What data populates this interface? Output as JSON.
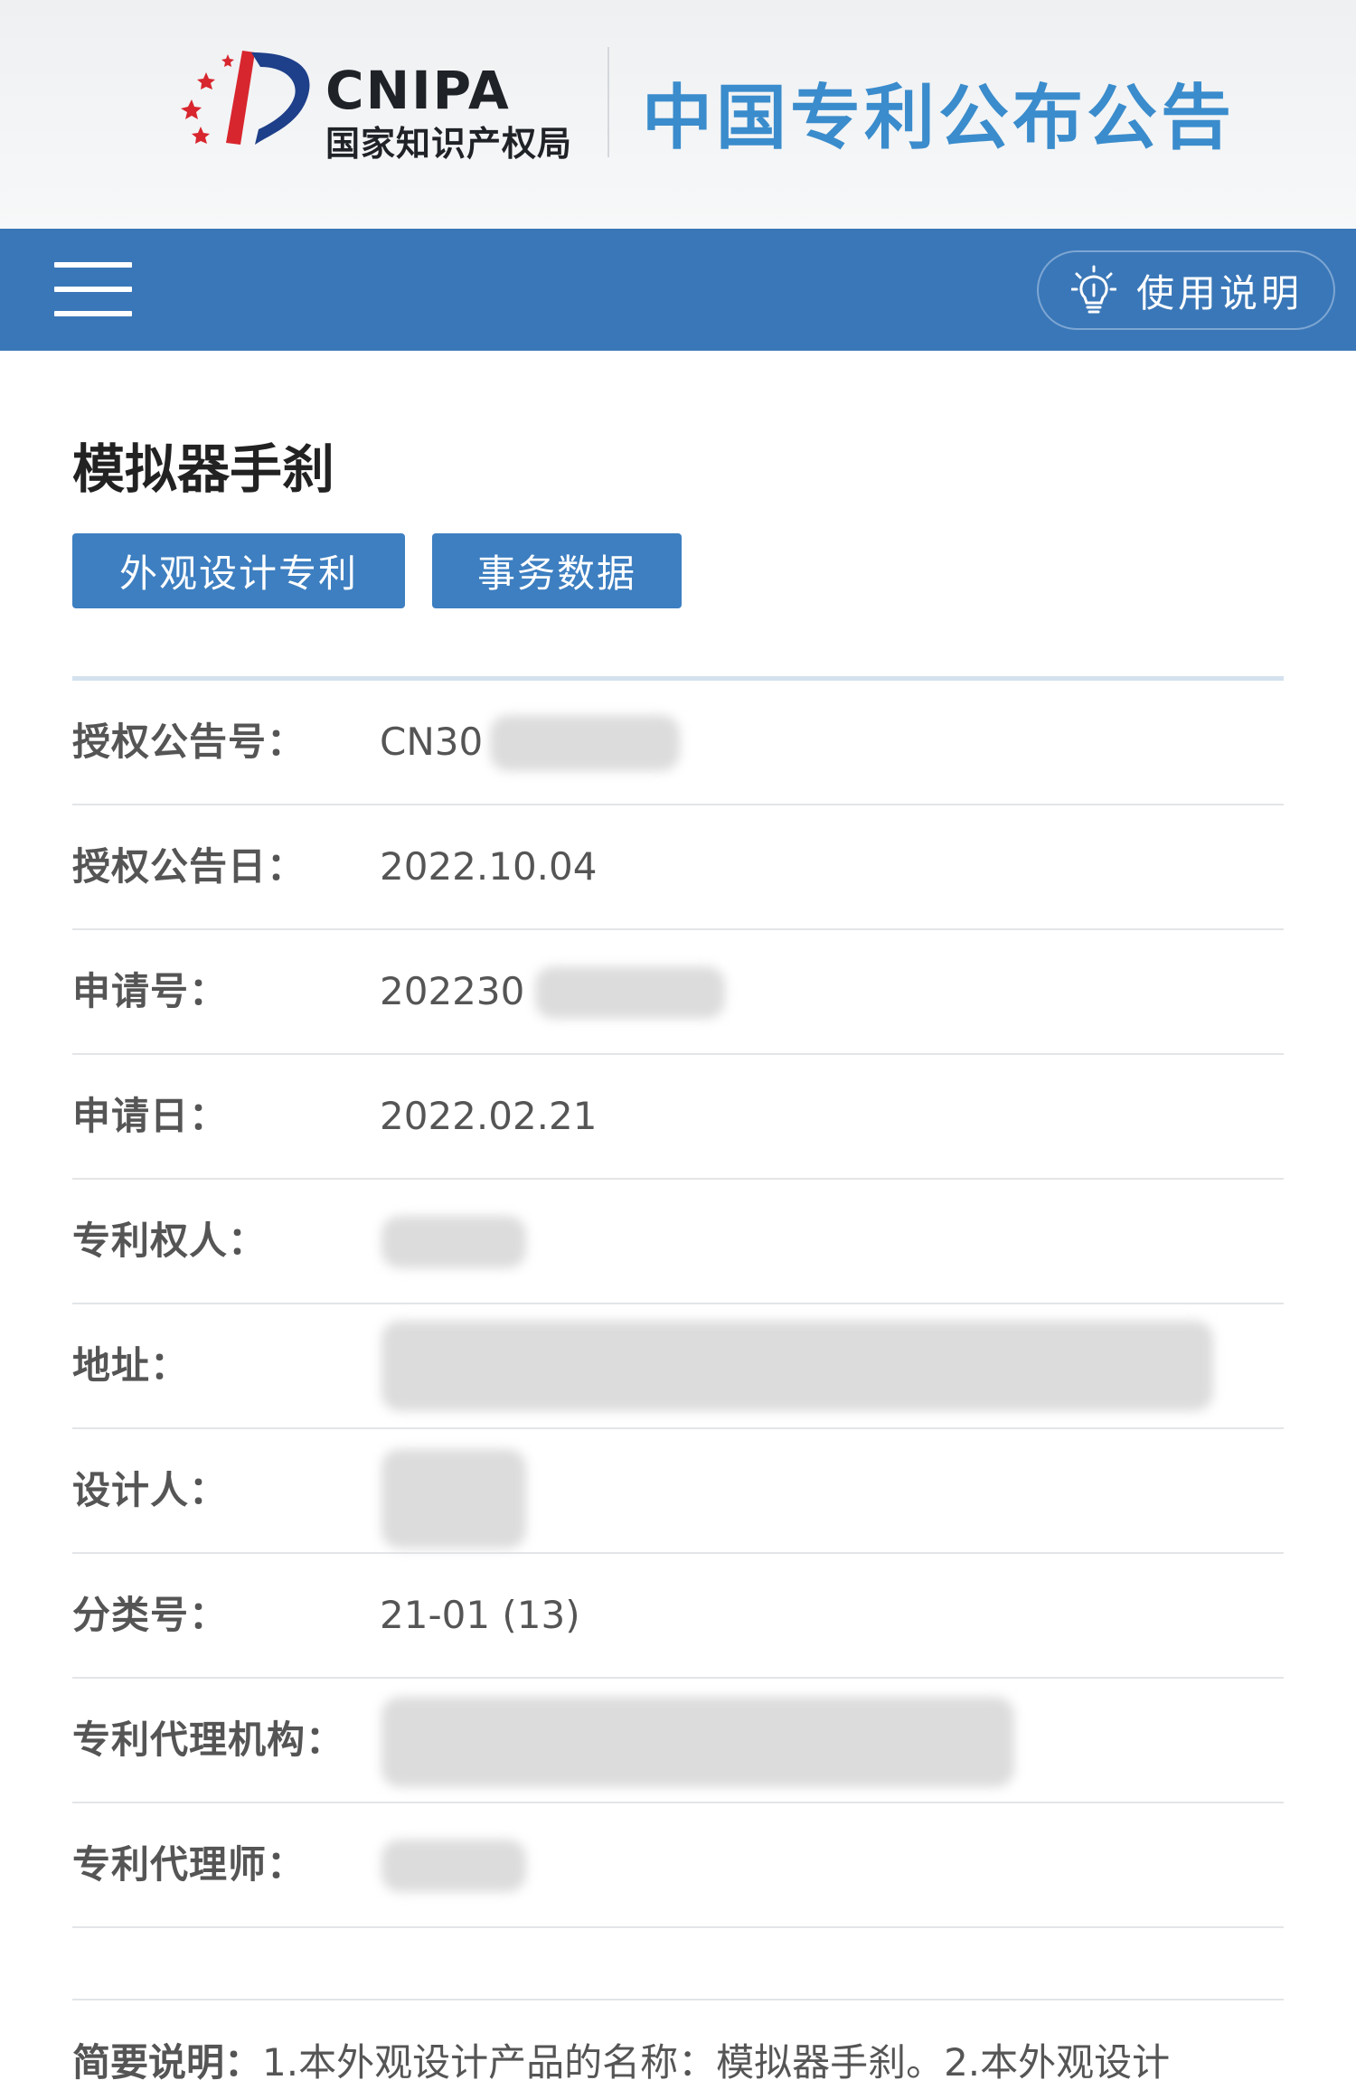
{
  "header": {
    "logo_en": "CNIPA",
    "logo_cn": "国家知识产权局",
    "site_title": "中国专利公布公告"
  },
  "navbar": {
    "menu_icon": "hamburger-menu-icon",
    "help_icon": "lightbulb-icon",
    "help_label": "使用说明"
  },
  "page": {
    "title": "模拟器手刹",
    "tabs": [
      {
        "label": "外观设计专利"
      },
      {
        "label": "事务数据"
      }
    ]
  },
  "fields": [
    {
      "label": "授权公告号：",
      "value": "CN30"
    },
    {
      "label": "授权公告日：",
      "value": "2022.10.04"
    },
    {
      "label": "申请号：",
      "value": "202230"
    },
    {
      "label": "申请日：",
      "value": "2022.02.21"
    },
    {
      "label": "专利权人：",
      "value": ""
    },
    {
      "label": "地址：",
      "value": ""
    },
    {
      "label": "设计人：",
      "value": ""
    },
    {
      "label": "分类号：",
      "value": "21-01 (13)"
    },
    {
      "label": "专利代理机构：",
      "value": ""
    },
    {
      "label": "专利代理师：",
      "value": ""
    }
  ],
  "summary": {
    "label": "简要说明：",
    "text": "1.本外观设计产品的名称：模拟器手刹。2.本外观设计"
  },
  "colors": {
    "navbar": "#3a77b8",
    "tab": "#3d7fc1",
    "title_blue": "#3a8ccc"
  }
}
